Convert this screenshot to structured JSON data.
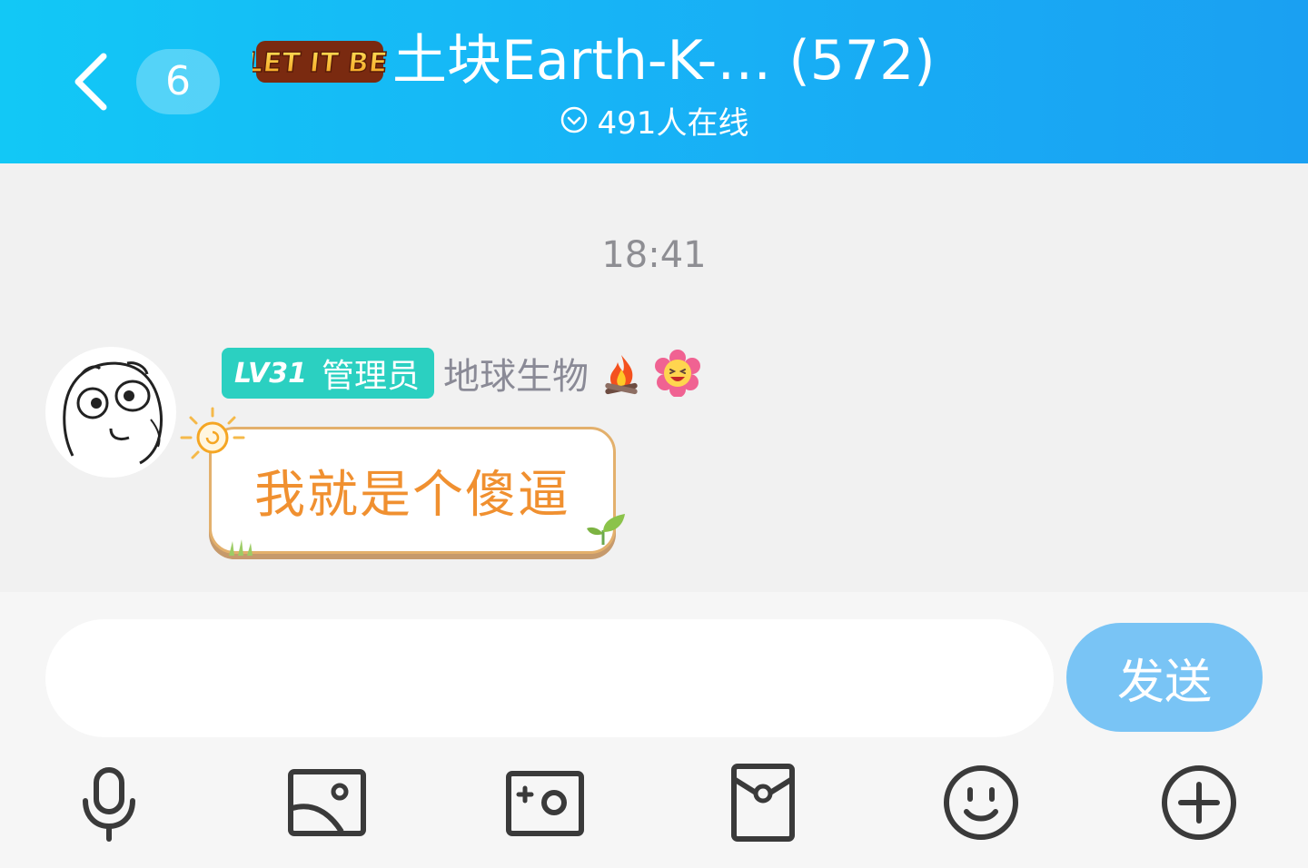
{
  "header": {
    "back_icon": "back-chevron-icon",
    "unread_count": "6",
    "logo_text": "LET IT BE",
    "group_title": "土块Earth-K-… (572)",
    "online_icon": "check-circle-icon",
    "online_text": "491人在线",
    "gradient_start": "#12c8f6",
    "gradient_end": "#1aa0f2"
  },
  "chat": {
    "timestamp": "18:41",
    "messages": [
      {
        "level": "LV31",
        "role": "管理员",
        "sender": "地球生物",
        "badges": [
          "campfire-emoji",
          "laughing-flower-emoji"
        ],
        "text": "我就是个傻逼",
        "bubble_text_color": "#f09030",
        "bubble_border_color": "#e3b06c"
      }
    ]
  },
  "composer": {
    "input_value": "",
    "input_placeholder": "",
    "send_label": "发送",
    "send_color": "#79c4f5"
  },
  "toolbar": [
    "microphone-icon",
    "image-icon",
    "camera-icon",
    "red-packet-icon",
    "smiley-icon",
    "plus-circle-icon"
  ]
}
